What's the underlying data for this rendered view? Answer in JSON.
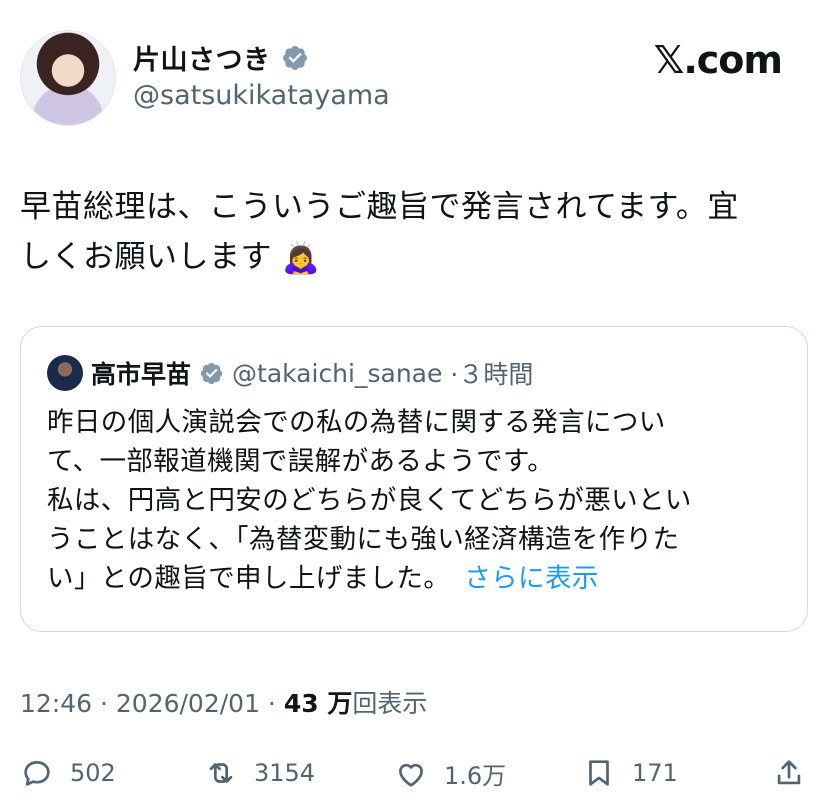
{
  "author": {
    "name": "片山さつき",
    "handle": "@satsukikatayama"
  },
  "brand": {
    "label": "𝕏.com"
  },
  "tweet": {
    "line1": "早苗総理は、こういうご趣旨で発言されてます。宜",
    "line2": "しくお願いします",
    "emoji": "🙇‍♀️"
  },
  "quote": {
    "name": "高市早苗",
    "handle": "@takaichi_sanae",
    "time": "·３時間",
    "lines": [
      "昨日の個人演説会での私の為替に関する発言につい",
      "て、一部報道機関で誤解があるようです。",
      "私は、円高と円安のどちらが良くてどちらが悪いとい",
      "うことはなく、「為替変動にも強い経済構造を作りた",
      "い」との趣旨で申し上げました。"
    ],
    "show_more": "さらに表示"
  },
  "meta": {
    "time": "12:46 · 2026/02/01 · ",
    "views": "43 万",
    "views_label": "回表示"
  },
  "actions": {
    "replies": "502",
    "retweets": "3154",
    "likes": "1.6万",
    "bookmarks": "171"
  },
  "colors": {
    "accent": "#1d9bf0",
    "muted": "#536471",
    "text": "#0f1419",
    "verified": "#829aab"
  }
}
